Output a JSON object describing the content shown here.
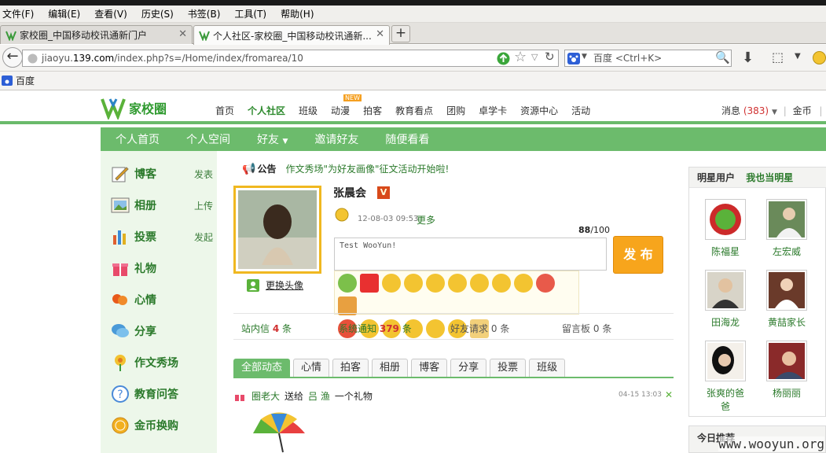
{
  "menubar": [
    "文件(F)",
    "编辑(E)",
    "查看(V)",
    "历史(S)",
    "书签(B)",
    "工具(T)",
    "帮助(H)"
  ],
  "tabs": [
    {
      "label": "家校圈_中国移动校讯通新门户"
    },
    {
      "label": "个人社区-家校圈_中国移动校讯通新..."
    }
  ],
  "url": {
    "prefix": "jiaoyu.",
    "host": "139.com",
    "path": "/index.php?s=/Home/index/fromarea/10"
  },
  "search": {
    "placeholder": "百度 <Ctrl+K>"
  },
  "bookmarks": {
    "item": "百度"
  },
  "site": {
    "logo": "家校圈",
    "nav": [
      "首页",
      "个人社区",
      "班级",
      "动漫",
      "拍客",
      "教育看点",
      "团购",
      "卓学卡",
      "资源中心",
      "活动"
    ],
    "nav_badge": "NEW",
    "msg_label": "消息",
    "msg_count": "(383)",
    "coins": "金币"
  },
  "subnav": [
    "个人首页",
    "个人空间",
    "好友",
    "邀请好友",
    "随便看看"
  ],
  "sidebar": [
    {
      "label": "博客",
      "action": "发表"
    },
    {
      "label": "相册",
      "action": "上传"
    },
    {
      "label": "投票",
      "action": "发起"
    },
    {
      "label": "礼物",
      "action": ""
    },
    {
      "label": "心情",
      "action": ""
    },
    {
      "label": "分享",
      "action": ""
    },
    {
      "label": "作文秀场",
      "action": ""
    },
    {
      "label": "教育问答",
      "action": ""
    },
    {
      "label": "金币换购",
      "action": ""
    }
  ],
  "notice": {
    "label": "公告",
    "text": "作文秀场\"为好友画像\"征文活动开始啦!"
  },
  "profile": {
    "name": "张晨会",
    "date": "12-08-03 09:53",
    "more": "更多",
    "change_avatar": "更换头像"
  },
  "composer": {
    "count": "88",
    "max": "/100",
    "text": "Test WooYun!",
    "publish": "发 布"
  },
  "stats": [
    {
      "label": "站内信",
      "value": "4",
      "unit": "条"
    },
    {
      "label": "系统通知",
      "value": "379",
      "unit": "条"
    },
    {
      "label": "好友请求",
      "value": "0",
      "unit": "条"
    },
    {
      "label": "留言板",
      "value": "0",
      "unit": "条"
    }
  ],
  "feed_tabs": [
    "全部动态",
    "心情",
    "拍客",
    "相册",
    "博客",
    "分享",
    "投票",
    "班级"
  ],
  "feed": {
    "user": "圈老大",
    "verb": "送给",
    "target": "吕 渔",
    "object": "一个礼物",
    "time": "04-15 13:03"
  },
  "stars": {
    "title": "明星用户",
    "link": "我也当明星",
    "users": [
      "陈福星",
      "左宏威",
      "田海龙",
      "黄喆家长",
      "张爽的爸爸",
      "杨丽丽"
    ]
  },
  "today": "今日推荐",
  "watermark": "www.wooyun.org"
}
